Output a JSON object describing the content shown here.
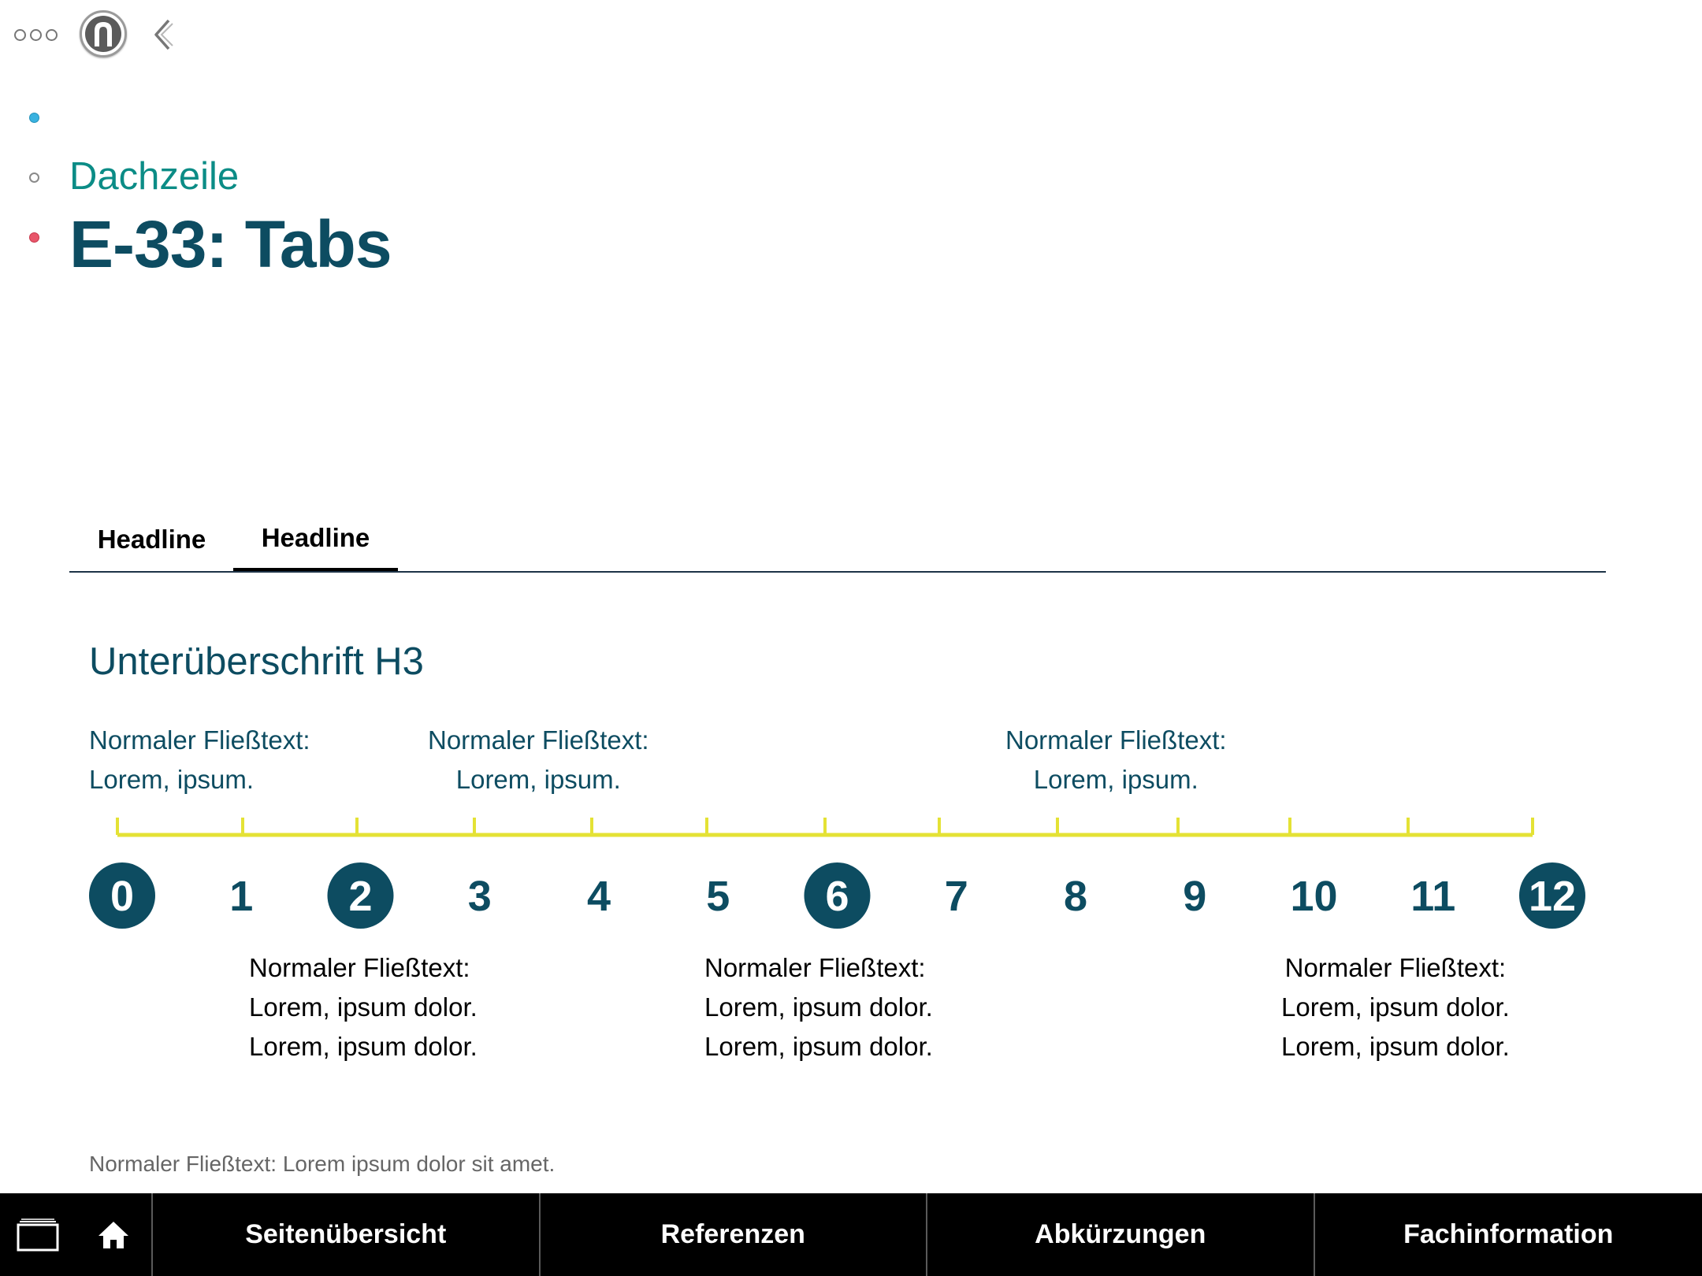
{
  "header": {
    "kicker": "Dachzeile",
    "title": "E-33: Tabs"
  },
  "toolbar": {
    "menu_icon": "more-dots-icon",
    "profile_icon": "profile-icon",
    "back_icon": "chevron-left-icon"
  },
  "tabs": [
    {
      "label": "Headline",
      "active": false
    },
    {
      "label": "Headline",
      "active": true
    }
  ],
  "content": {
    "subheading": "Unterüberschrift H3",
    "upper_notes": [
      {
        "line1": "Normaler Fließtext:",
        "line2": "Lorem, ipsum."
      },
      {
        "line1": "Normaler Fließtext:",
        "line2": "Lorem, ipsum."
      },
      {
        "line1": "Normaler Fließtext:",
        "line2": "Lorem, ipsum."
      }
    ],
    "lower_notes": [
      {
        "line1": "Normaler Fließtext:",
        "line2": "Lorem, ipsum dolor.",
        "line3": "Lorem, ipsum dolor."
      },
      {
        "line1": "Normaler Fließtext:",
        "line2": "Lorem, ipsum dolor.",
        "line3": "Lorem, ipsum dolor."
      },
      {
        "line1": "Normaler Fließtext:",
        "line2": "Lorem, ipsum dolor.",
        "line3": "Lorem, ipsum dolor."
      }
    ],
    "footnote": "Normaler Fließtext: Lorem ipsum dolor sit amet."
  },
  "timeline": {
    "numbers": [
      "0",
      "1",
      "2",
      "3",
      "4",
      "5",
      "6",
      "7",
      "8",
      "9",
      "10",
      "11",
      "12"
    ],
    "highlighted": [
      "0",
      "2",
      "6",
      "12"
    ],
    "accent_color": "#0d4c61",
    "scale_color": "#e4e235"
  },
  "bottom_bar": {
    "windows_icon": "windows-icon",
    "home_icon": "home-icon",
    "items": [
      "Seitenübersicht",
      "Referenzen",
      "Abkürzungen",
      "Fachinformation"
    ]
  }
}
